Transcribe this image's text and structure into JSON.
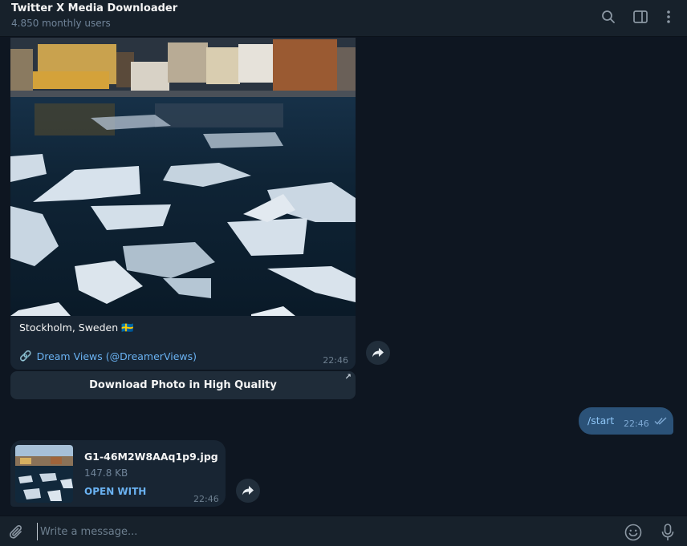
{
  "header": {
    "title": "Twitter X Media Downloader",
    "subtitle": "4.850 monthly users"
  },
  "message_1": {
    "caption": "Stockholm, Sweden",
    "caption_flag": "🇸🇪",
    "link_icon": "🔗",
    "link_text": "Dream Views (@DreamerViews)",
    "time": "22:46",
    "button_label": "Download Photo in High Quality",
    "button_arrow": "↗"
  },
  "message_2": {
    "text": "/start",
    "time": "22:46"
  },
  "message_3": {
    "file_name": "G1-46M2W8AAq1p9.jpg",
    "file_size": "147.8 KB",
    "open_with": "OPEN WITH",
    "time": "22:46"
  },
  "composer": {
    "placeholder": "Write a message..."
  },
  "colors": {
    "background": "#0e1621",
    "panel": "#17212b",
    "incoming_bubble": "#182533",
    "outgoing_bubble": "#2b5278",
    "link": "#6ab2f2"
  }
}
